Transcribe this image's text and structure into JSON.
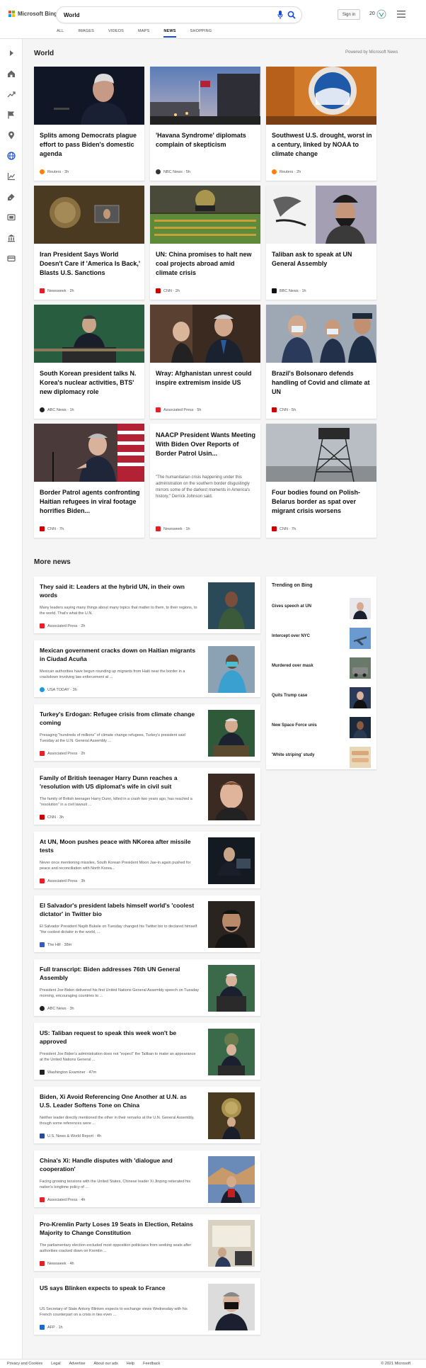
{
  "header": {
    "logo_text": "Microsoft Bing",
    "search_value": "World",
    "signin_label": "Sign in",
    "points": "20",
    "colors": {
      "ms_red": "#f25022",
      "ms_green": "#7fba00",
      "ms_blue": "#00a4ef",
      "ms_yellow": "#ffb900",
      "accent": "#174ae4"
    }
  },
  "nav": {
    "tabs": [
      "ALL",
      "IMAGES",
      "VIDEOS",
      "MAPS",
      "NEWS",
      "SHOPPING"
    ],
    "active": "NEWS"
  },
  "rail": {
    "icons": [
      "expand-icon",
      "home-icon",
      "trending-icon",
      "flag-icon",
      "location-icon",
      "globe-icon",
      "chart-icon",
      "science-icon",
      "tv-icon",
      "bank-icon",
      "card-icon"
    ]
  },
  "world": {
    "title": "World",
    "powered_by": "Powered by Microsoft News",
    "cards": [
      {
        "title": "Splits among Democrats plague effort to pass Biden's domestic agenda",
        "source": "Reuters · 3h",
        "logo": "reuters-logo"
      },
      {
        "title": "'Havana Syndrome' diplomats complain of skepticism",
        "source": "NBC News · 5h",
        "logo": "nbc-logo"
      },
      {
        "title": "Southwest U.S. drought, worst in a century, linked by NOAA to climate change",
        "source": "Reuters · 2h",
        "logo": "reuters-logo"
      },
      {
        "title": "Iran President Says World Doesn't Care if 'America Is Back,' Blasts U.S. Sanctions",
        "source": "Newsweek · 2h",
        "logo": "newsweek-logo"
      },
      {
        "title": "UN: China promises to halt new coal projects abroad amid climate crisis",
        "source": "CNN · 2h",
        "logo": "cnn-logo"
      },
      {
        "title": "Taliban ask to speak at UN General Assembly",
        "source": "BBC News · 1h",
        "logo": "bbc-logo"
      },
      {
        "title": "South Korean president talks N. Korea's nuclear activities, BTS' new diplomacy role",
        "source": "ABC News · 1h",
        "logo": "abc-logo"
      },
      {
        "title": "Wray: Afghanistan unrest could inspire extremism inside US",
        "source": "Associated Press · 5h",
        "logo": "ap-logo"
      },
      {
        "title": "Brazil's Bolsonaro defends handling of Covid and climate at UN",
        "source": "CNN · 5h",
        "logo": "cnn-logo"
      },
      {
        "title": "Border Patrol agents confronting Haitian refugees in viral footage horrifies Biden...",
        "source": "CNN · 7h",
        "logo": "cnn-logo"
      },
      {
        "title": "NAACP President Wants Meeting With Biden Over Reports of Border Patrol Usin...",
        "quote": "\"The humanitarian crisis happening under this administration on the southern border disgustingly mirrors some of the darkest moments in America's history,\" Derrick Johnson said.",
        "source": "Newsweek · 1h",
        "logo": "newsweek-logo"
      },
      {
        "title": "Four bodies found on Polish-Belarus border as spat over migrant crisis worsens",
        "source": "CNN · 7h",
        "logo": "cnn-logo"
      }
    ]
  },
  "more_news": {
    "title": "More news",
    "items": [
      {
        "title": "They said it: Leaders at the hybrid UN, in their own words",
        "snippet": "Many leaders saying many things about many topics that matter to them, to their regions, to the world. That's what the U.N.",
        "source": "Associated Press · 2h",
        "logo": "ap-logo"
      },
      {
        "title": "Mexican government cracks down on Haitian migrants in Ciudad Acuña",
        "snippet": "Mexican authorities have begun rounding up migrants from Haiti near the border in a crackdown involving law enforcement at ...",
        "source": "USA TODAY · 3h",
        "logo": "usatoday-logo"
      },
      {
        "title": "Turkey's Erdogan: Refugee crisis from climate change coming",
        "snippet": "Presaging \"hundreds of millions\" of climate change refugees, Turkey's president said Tuesday at the U.N. General Assembly ...",
        "source": "Associated Press · 2h",
        "logo": "ap-logo"
      },
      {
        "title": "Family of British teenager Harry Dunn reaches a 'resolution with US diplomat's wife in civil suit",
        "snippet": "The family of British teenager Harry Dunn, killed in a crash two years ago, has reached a \"resolution\" in a civil lawsuit ...",
        "source": "CNN · 3h",
        "logo": "cnn-logo"
      },
      {
        "title": "At UN, Moon pushes peace with NKorea after missile tests",
        "snippet": "Never once mentioning missiles, South Korean President Moon Jae-in again pushed for peace and reconciliation with North Korea...",
        "source": "Associated Press · 3h",
        "logo": "ap-logo"
      },
      {
        "title": "El Salvador's president labels himself world's 'coolest dictator' in Twitter bio",
        "snippet": "El Salvador President Nayib Bukele on Tuesday changed his Twitter bio to declared himself \"the coolest dictator in the world, ...",
        "source": "The Hill · 38m",
        "logo": "thehill-logo"
      },
      {
        "title": "Full transcript: Biden addresses 76th UN General Assembly",
        "snippet": "President Joe Biden delivered his first United Nations General Assembly speech on Tuesday morning, encouraging countries to ...",
        "source": "ABC News · 3h",
        "logo": "abc-logo"
      },
      {
        "title": "US: Taliban request to speak this week won't be approved",
        "snippet": "President Joe Biden's administration does not \"expect\" the Taliban to make an appearance at the United Nations General ...",
        "source": "Washington Examiner · 47m",
        "logo": "examiner-logo"
      },
      {
        "title": "Biden, Xi Avoid Referencing One Another at U.N. as U.S. Leader Softens Tone on China",
        "snippet": "Neither leader directly mentioned the other in their remarks at the U.N. General Assembly, though some references were ...",
        "source": "U.S. News & World Report · 4h",
        "logo": "usnews-logo"
      },
      {
        "title": "China's Xi: Handle disputes with 'dialogue and cooperation'",
        "snippet": "Facing growing tensions with the United States, Chinese leader Xi Jinping reiterated his nation's longtime policy of ...",
        "source": "Associated Press · 4h",
        "logo": "ap-logo"
      },
      {
        "title": "Pro-Kremlin Party Loses 19 Seats in Election, Retains Majority to Change Constitution",
        "snippet": "The parliamentary election excluded most opposition politicians from seeking seats after authorities cracked down on Kremlin ...",
        "source": "Newsweek · 4h",
        "logo": "newsweek-logo"
      },
      {
        "title": "US says Blinken expects to speak to France",
        "snippet": "US Secretary of State Antony Blinken expects to exchange views Wednesday with his French counterpart on a crisis in ties even ...",
        "source": "AFP · 1h",
        "logo": "afp-logo"
      }
    ]
  },
  "trending": {
    "title": "Trending on Bing",
    "items": [
      "Gives speech at UN",
      "Intercept over NYC",
      "Murdered over mask",
      "Quits Trump case",
      "New Space Force unis",
      "'White striping' study"
    ]
  },
  "footer": {
    "links": [
      "Privacy and Cookies",
      "Legal",
      "Advertise",
      "About our ads",
      "Help",
      "Feedback"
    ],
    "copyright": "© 2021 Microsoft"
  }
}
